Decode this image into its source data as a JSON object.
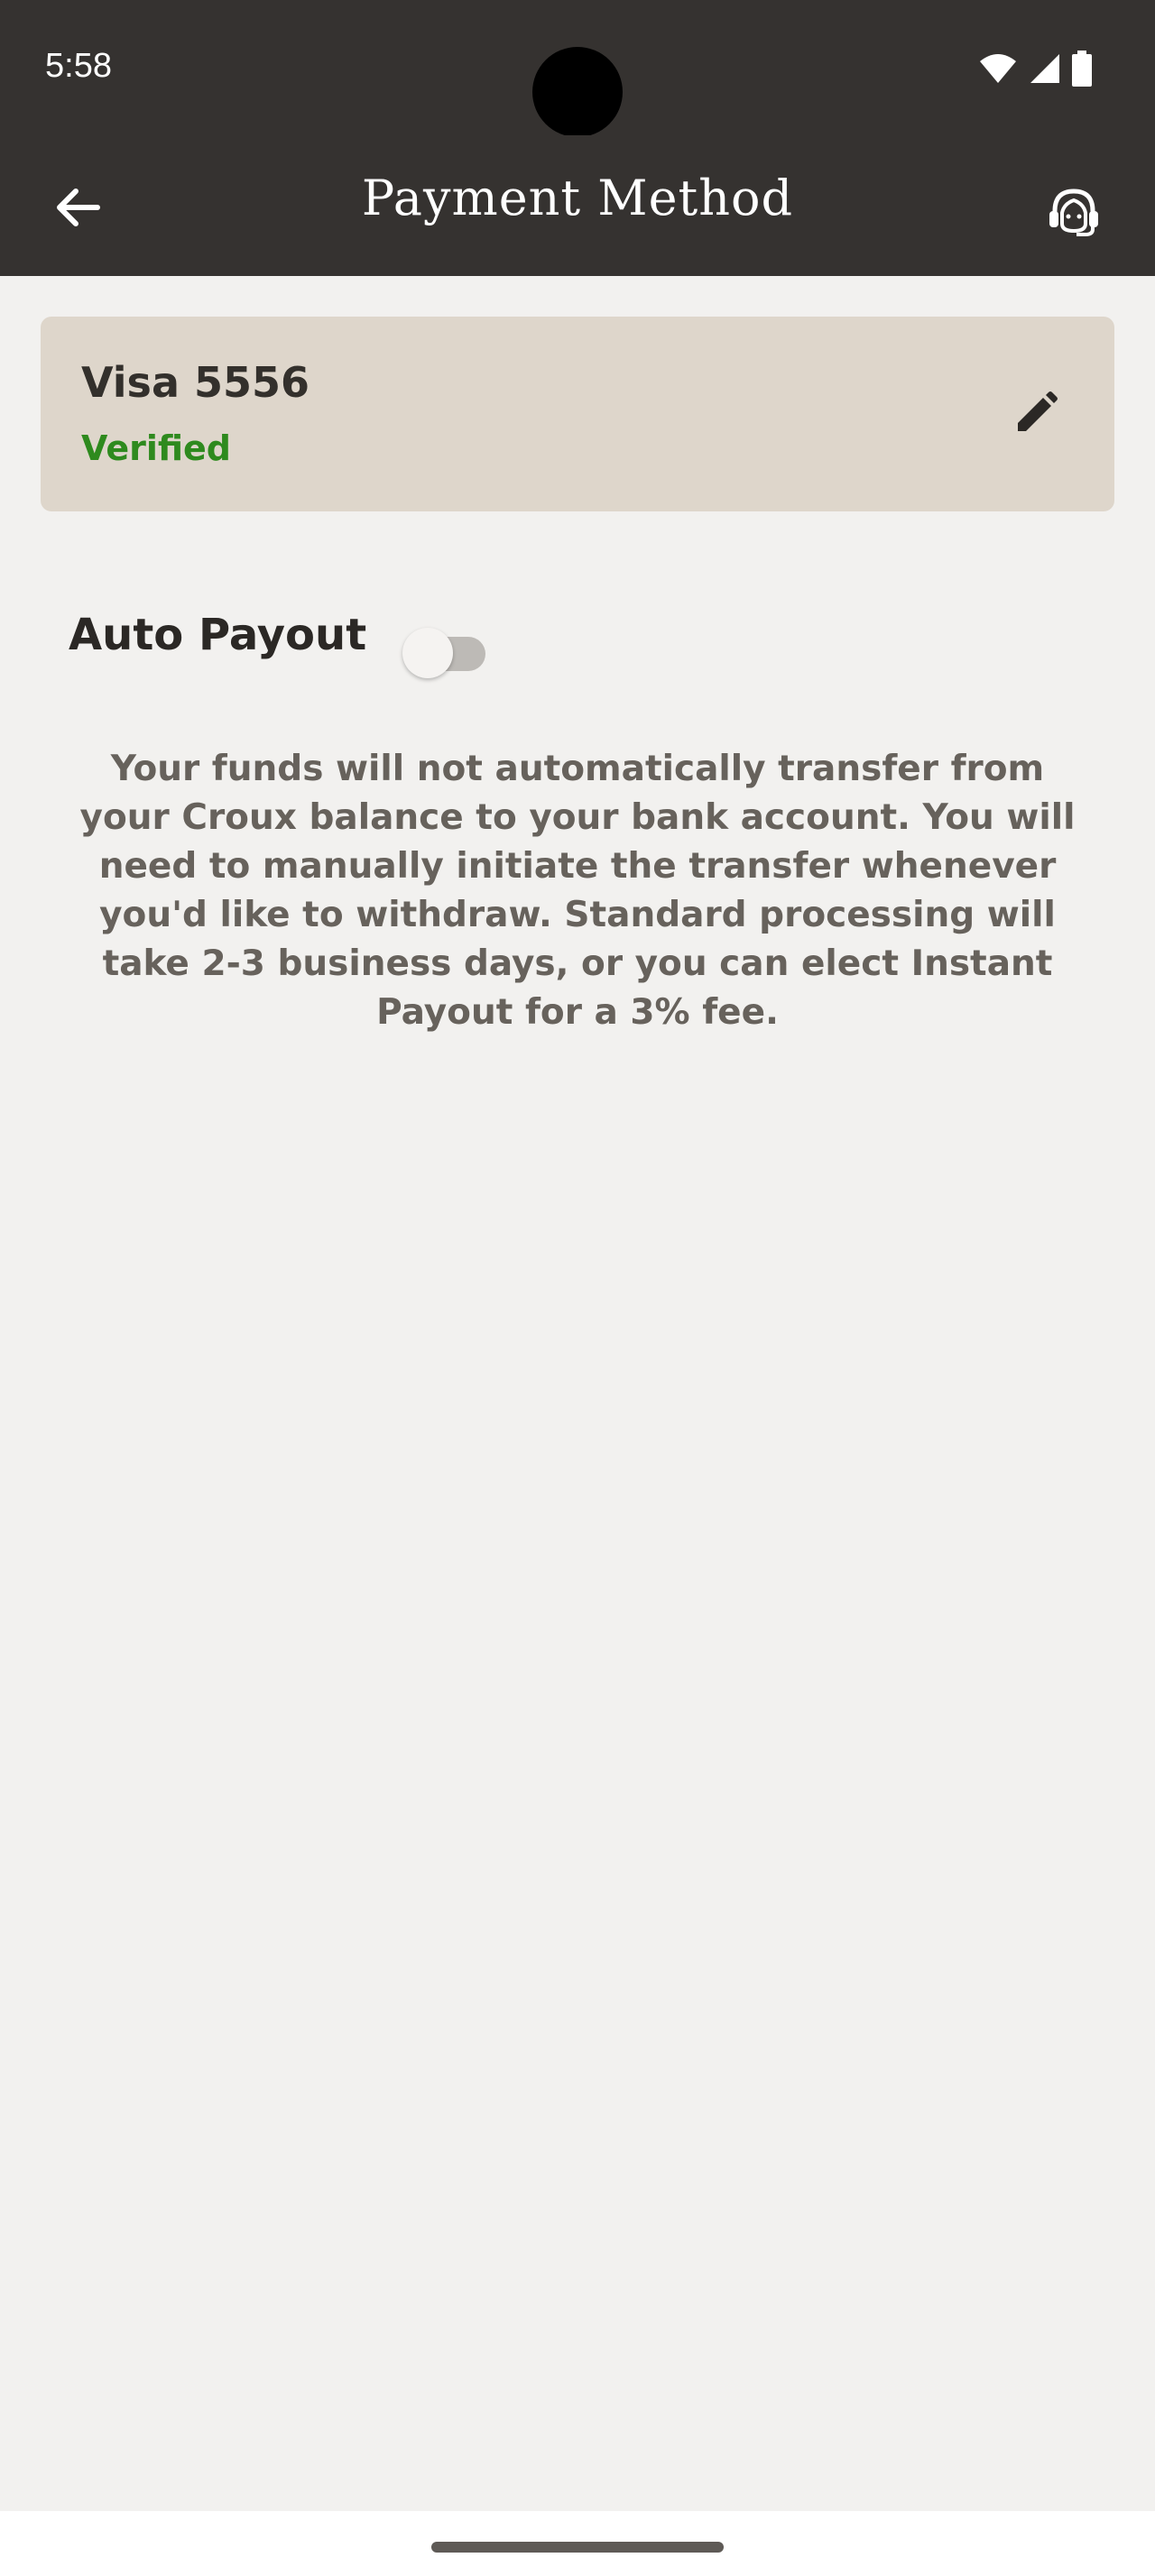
{
  "status_bar": {
    "time": "5:58",
    "icons": [
      "wifi-icon",
      "signal-icon",
      "battery-icon"
    ]
  },
  "app_bar": {
    "title": "Payment Method",
    "back_icon": "arrow-left-icon",
    "support_icon": "headset-support-icon"
  },
  "payment_card": {
    "title": "Visa 5556",
    "status": "Verified",
    "status_color": "#2e8a1e",
    "background_color": "#ded6cb",
    "edit_icon": "pencil-icon"
  },
  "auto_payout": {
    "label": "Auto Payout",
    "enabled": false,
    "description": "Your funds will not automatically transfer from your Croux balance to your bank account. You will need to manually initiate the transfer whenever you'd like to withdraw. Standard processing will take 2-3 business days, or you can elect Instant Payout for a 3% fee."
  },
  "colors": {
    "header": "#353230",
    "background": "#f2f1ef"
  }
}
